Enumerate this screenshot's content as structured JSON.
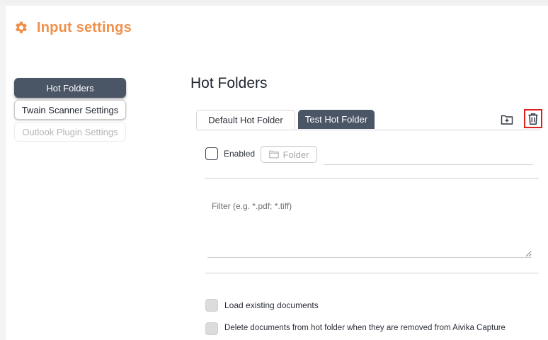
{
  "header": {
    "title": "Input settings",
    "icon": "gear-icon",
    "accent_color": "#f0904a"
  },
  "sidebar": {
    "items": [
      {
        "label": "Hot Folders",
        "state": "active"
      },
      {
        "label": "Twain Scanner Settings",
        "state": "normal"
      },
      {
        "label": "Outlook Plugin Settings",
        "state": "disabled"
      }
    ]
  },
  "main": {
    "title": "Hot Folders",
    "tabs": [
      {
        "label": "Default Hot Folder",
        "active": false
      },
      {
        "label": "Test Hot Folder",
        "active": true
      }
    ],
    "toolbar": {
      "add_icon": "add-folder-icon",
      "delete_icon": "trash-icon",
      "delete_highlight_color": "#e0201c"
    },
    "enabled": {
      "label": "Enabled",
      "checked": false
    },
    "folder_button": {
      "label": "Folder",
      "icon": "folder-icon"
    },
    "path": {
      "value": ""
    },
    "filter": {
      "placeholder": "Filter (e.g. *.pdf; *.tiff)",
      "value": ""
    },
    "load_existing": {
      "label": "Load existing documents",
      "checked": false
    },
    "delete_docs": {
      "label": "Delete documents from hot folder when they are removed from Aivika Capture",
      "checked": false
    }
  }
}
